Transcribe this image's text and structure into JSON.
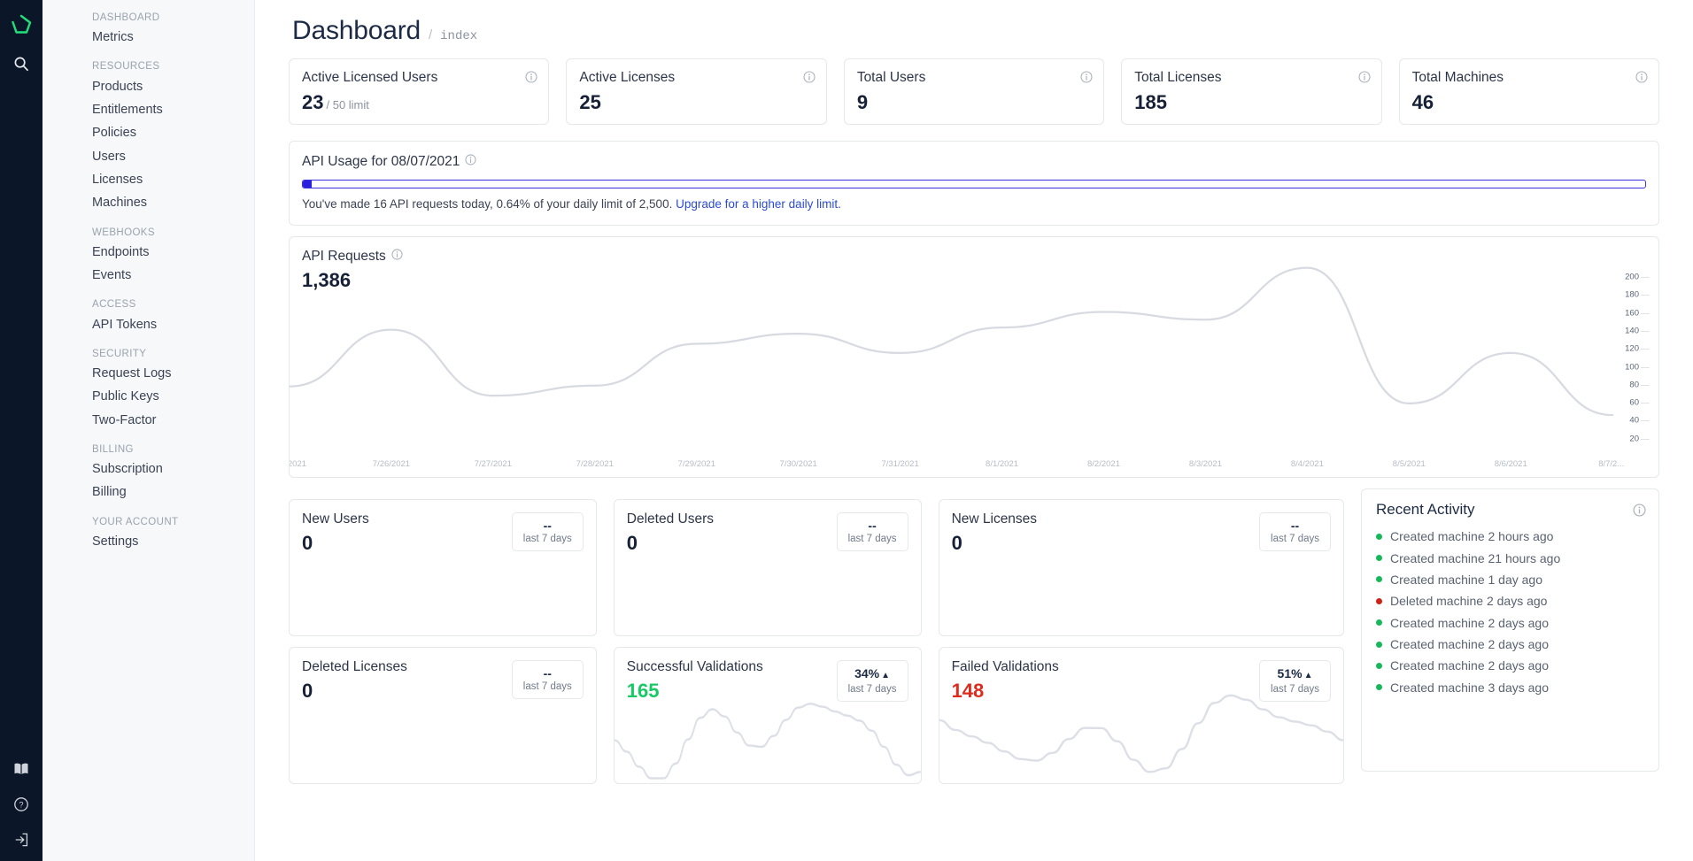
{
  "rail": {
    "logo_icon": "pentagon-logo-icon",
    "logo_color": "#21e07a",
    "search_icon": "search-icon",
    "bottom_icons": [
      "book-icon",
      "help-circle-icon",
      "logout-icon"
    ]
  },
  "sidebar": {
    "groups": [
      {
        "label": "DASHBOARD",
        "items": [
          "Metrics"
        ]
      },
      {
        "label": "RESOURCES",
        "items": [
          "Products",
          "Entitlements",
          "Policies",
          "Users",
          "Licenses",
          "Machines"
        ]
      },
      {
        "label": "WEBHOOKS",
        "items": [
          "Endpoints",
          "Events"
        ]
      },
      {
        "label": "ACCESS",
        "items": [
          "API Tokens"
        ]
      },
      {
        "label": "SECURITY",
        "items": [
          "Request Logs",
          "Public Keys",
          "Two-Factor"
        ]
      },
      {
        "label": "BILLING",
        "items": [
          "Subscription",
          "Billing"
        ]
      },
      {
        "label": "YOUR ACCOUNT",
        "items": [
          "Settings"
        ]
      }
    ]
  },
  "header": {
    "title": "Dashboard",
    "separator": "/",
    "crumb": "index"
  },
  "kpis": [
    {
      "title": "Active Licensed Users",
      "value": "23",
      "sub": "/ 50 limit",
      "info_icon": "info-icon"
    },
    {
      "title": "Active Licenses",
      "value": "25",
      "sub": "",
      "info_icon": "info-icon"
    },
    {
      "title": "Total Users",
      "value": "9",
      "sub": "",
      "info_icon": "info-icon"
    },
    {
      "title": "Total Licenses",
      "value": "185",
      "sub": "",
      "info_icon": "info-icon"
    },
    {
      "title": "Total Machines",
      "value": "46",
      "sub": "",
      "info_icon": "info-icon"
    }
  ],
  "api_usage": {
    "title": "API Usage for 08/07/2021",
    "info_icon": "info-icon",
    "percent": 0.64,
    "bar_color": "#2b1fe0",
    "text_before": "You've made 16 API requests today, 0.64% of your daily limit of 2,500. ",
    "link_text": "Upgrade for a higher daily limit."
  },
  "api_requests": {
    "title": "API Requests",
    "info_icon": "info-icon",
    "value": "1,386"
  },
  "chart_data": {
    "type": "line",
    "title": "API Requests",
    "xlabel": "",
    "ylabel": "",
    "ylim": [
      0,
      210
    ],
    "yticks": [
      20,
      40,
      60,
      80,
      100,
      120,
      140,
      160,
      180,
      200
    ],
    "grid": false,
    "legend": "none",
    "line_color": "#d7dae1",
    "x": [
      "2021",
      "7/26/2021",
      "7/27/2021",
      "7/28/2021",
      "7/29/2021",
      "7/30/2021",
      "7/31/2021",
      "8/1/2021",
      "8/2/2021",
      "8/3/2021",
      "8/4/2021",
      "8/5/2021",
      "8/6/2021",
      "8/7/2..."
    ],
    "series": [
      {
        "name": "API Requests",
        "values": [
          52,
          125,
          40,
          53,
          107,
          120,
          95,
          128,
          148,
          138,
          205,
          30,
          95,
          15
        ]
      }
    ]
  },
  "mini_cards_row1": [
    {
      "title": "New Users",
      "value": "0",
      "value_color": "default",
      "badge_top": "--",
      "badge_up": "",
      "badge_sub": "last 7 days",
      "spark": false
    },
    {
      "title": "Deleted Users",
      "value": "0",
      "value_color": "default",
      "badge_top": "--",
      "badge_up": "",
      "badge_sub": "last 7 days",
      "spark": false
    },
    {
      "title": "New Licenses",
      "value": "0",
      "value_color": "default",
      "badge_top": "--",
      "badge_up": "",
      "badge_sub": "last 7 days",
      "spark": false
    }
  ],
  "mini_cards_row2": [
    {
      "title": "Deleted Licenses",
      "value": "0",
      "value_color": "default",
      "badge_top": "--",
      "badge_up": "",
      "badge_sub": "last 7 days",
      "spark": false
    },
    {
      "title": "Successful Validations",
      "value": "165",
      "value_color": "green",
      "badge_top": "34%",
      "badge_up": "▲",
      "badge_sub": "last 7 days",
      "spark": true
    },
    {
      "title": "Failed Validations",
      "value": "148",
      "value_color": "red",
      "badge_top": "51%",
      "badge_up": "▲",
      "badge_sub": "last 7 days",
      "spark": true
    }
  ],
  "activity": {
    "title": "Recent Activity",
    "info_icon": "info-icon",
    "items": [
      {
        "text": "Created machine 2 hours ago",
        "status": "green"
      },
      {
        "text": "Created machine 21 hours ago",
        "status": "green"
      },
      {
        "text": "Created machine 1 day ago",
        "status": "green"
      },
      {
        "text": "Deleted machine 2 days ago",
        "status": "red"
      },
      {
        "text": "Created machine 2 days ago",
        "status": "green"
      },
      {
        "text": "Created machine 2 days ago",
        "status": "green"
      },
      {
        "text": "Created machine 2 days ago",
        "status": "green"
      },
      {
        "text": "Created machine 3 days ago",
        "status": "green"
      }
    ]
  },
  "colors": {
    "rail_bg": "#0b1628",
    "sidebar_bg": "#f7f8fa",
    "accent_green": "#17c964",
    "accent_red": "#dd2b1c",
    "link_blue": "#2b4bd6",
    "title_navy": "#162036"
  }
}
